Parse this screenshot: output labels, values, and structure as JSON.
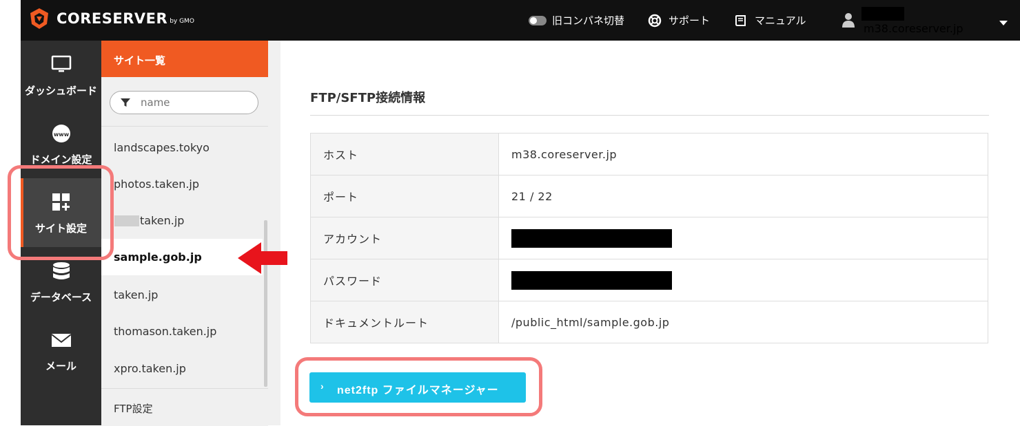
{
  "header": {
    "logo_text": "CORESERVER",
    "logo_by": "by GMO",
    "old_panel_label": "旧コンパネ切替",
    "support_label": "サポート",
    "manual_label": "マニュアル",
    "server_host": "m38.coreserver.jp"
  },
  "leftnav": {
    "items": [
      {
        "label": "ダッシュボード"
      },
      {
        "label": "ドメイン設定"
      },
      {
        "label": "サイト設定"
      },
      {
        "label": "データベース"
      },
      {
        "label": "メール"
      }
    ]
  },
  "sidepanel": {
    "title": "サイト一覧",
    "filter_placeholder": "name",
    "sites": [
      "landscapes.tokyo",
      "photos.taken.jp",
      "taken.jp",
      "sample.gob.jp",
      "taken.jp",
      "thomason.taken.jp",
      "xpro.taken.jp"
    ],
    "ftp_link": "FTP設定"
  },
  "main": {
    "title": "FTP/SFTP接続情報",
    "rows": [
      {
        "key": "ホスト",
        "value": "m38.coreserver.jp"
      },
      {
        "key": "ポート",
        "value": "21 / 22"
      },
      {
        "key": "アカウント",
        "value": ""
      },
      {
        "key": "パスワード",
        "value": ""
      },
      {
        "key": "ドキュメントルート",
        "value": "/public_html/sample.gob.jp"
      }
    ],
    "button_label": "net2ftp ファイルマネージャー",
    "button_chevron": "›"
  },
  "colors": {
    "brand_orange": "#f05a22",
    "button_cyan": "#1ec2e8",
    "highlight_red": "#f47a7a",
    "arrow_red": "#e8141c"
  }
}
